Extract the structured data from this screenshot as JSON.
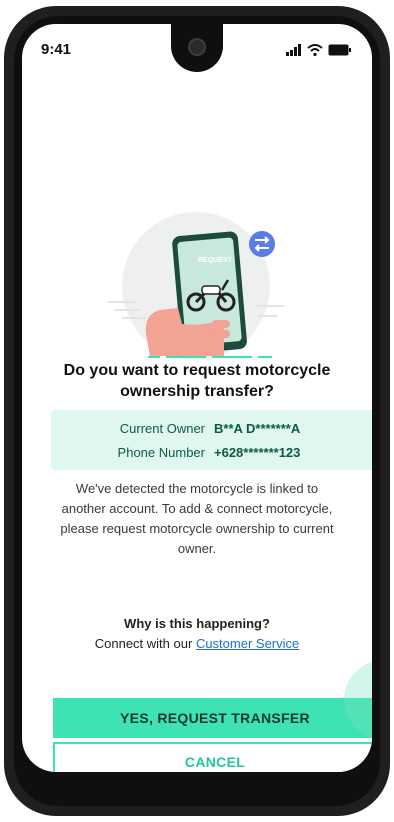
{
  "status_bar": {
    "time": "9:41",
    "icons": [
      "signal-icon",
      "wifi-icon",
      "battery-icon"
    ]
  },
  "illustration": {
    "phone_tag": "REQUEST",
    "icons": [
      "transfer-arrows-icon",
      "motorcycle-icon"
    ]
  },
  "dialog": {
    "title_line1": "Do you want to request motorcycle",
    "title_line2": "ownership transfer?",
    "owner_label": "Current Owner",
    "owner_value": "B**A D*******A",
    "phone_label": "Phone Number",
    "phone_value": "+628*******123",
    "desc_line1": "We've detected the motorcycle is linked to",
    "desc_line2": "another account. To add & connect motorcycle,",
    "desc_line3": "please request motorcycle ownership to current",
    "desc_line4": "owner.",
    "why": "Why is this happening?",
    "connect_text": "Connect with our",
    "cs_link": "Customer Service"
  },
  "buttons": {
    "yes": "YES, REQUEST TRANSFER",
    "cancel": "CANCEL"
  },
  "colors": {
    "accent": "#3ee2b3",
    "info_bg": "#dff7ef",
    "link": "#1f6fd1",
    "transfer_badge": "#5b7be6"
  }
}
